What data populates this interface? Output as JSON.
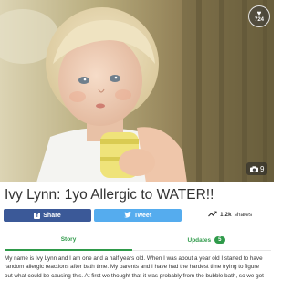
{
  "campaign": {
    "title": "Ivy Lynn: 1yo Allergic to WATER!!",
    "hearts_count": "724",
    "photo_count": "9"
  },
  "share": {
    "facebook_label": "Share",
    "twitter_label": "Tweet",
    "shares_count": "1.2k",
    "shares_suffix": "shares"
  },
  "tabs": {
    "story_label": "Story",
    "updates_label": "Updates",
    "updates_count": "5"
  },
  "story": {
    "lines": [
      "My name is Ivy Lynn and I am one and a half years old. When I was about a year old I started to have",
      "random allergic reactions after bath time. My parents and I have had the hardest time trying to figure",
      "out what could be causing this. At first we thought that it was probably from the bubble bath, so we got"
    ]
  },
  "icons": {
    "heart": "heart-icon",
    "camera": "camera-icon",
    "facebook": "facebook-icon",
    "twitter": "twitter-icon",
    "trend": "trending-up-icon"
  },
  "colors": {
    "facebook": "#3b5998",
    "twitter": "#55acee",
    "accent_green": "#2f9a4a"
  }
}
